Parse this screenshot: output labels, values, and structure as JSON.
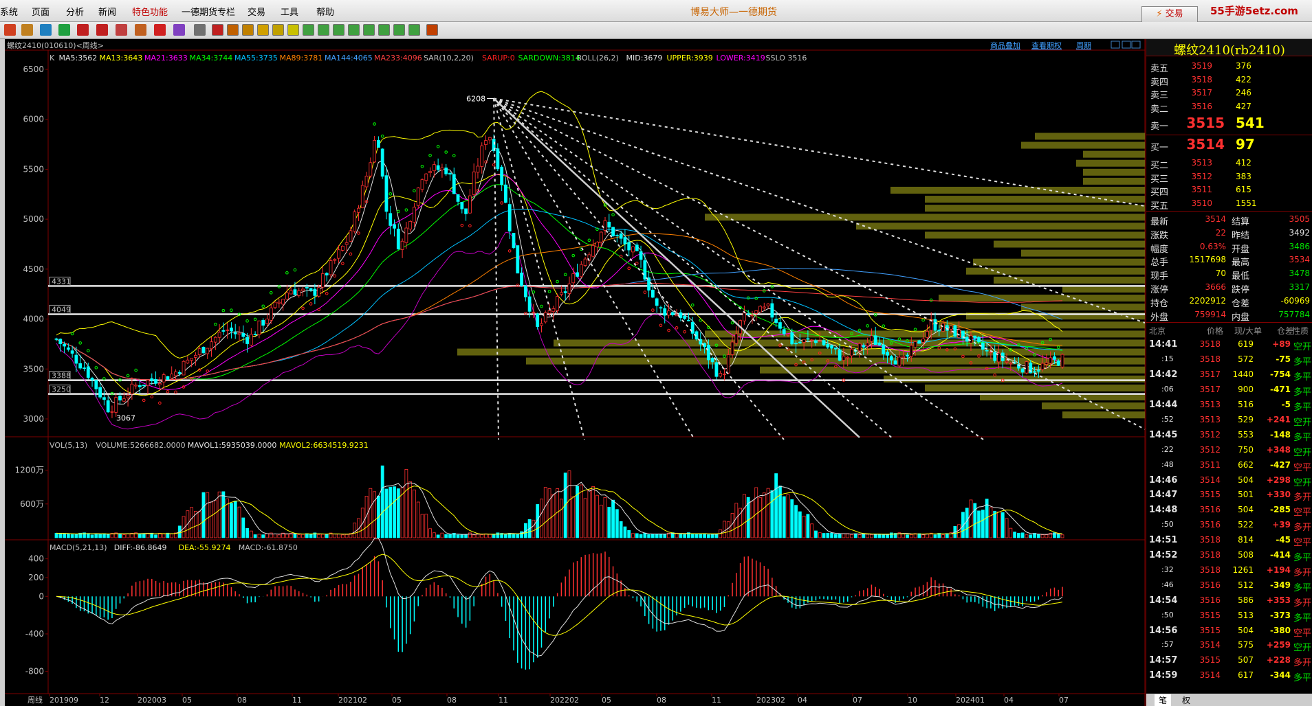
{
  "app": {
    "title": "博易大师—一德期货",
    "menus": [
      "系统",
      "页面",
      "分析",
      "新闻",
      "特色功能",
      "一德期货专栏",
      "交易",
      "工具",
      "帮助"
    ],
    "trade_button": "交易",
    "watermark": "55手游5etz.com"
  },
  "chart": {
    "title": "螺纹2410(010610)<周线>",
    "top_links": [
      "商品叠加",
      "查看期权",
      "周期"
    ],
    "indicator_line": [
      {
        "text": "K",
        "color": "#c0c0c0"
      },
      {
        "text": "MA5:3562",
        "color": "#e0e0e0"
      },
      {
        "text": "MA13:3643",
        "color": "#ffff00"
      },
      {
        "text": "MA21:3633",
        "color": "#ff00ff"
      },
      {
        "text": "MA34:3744",
        "color": "#00ff00"
      },
      {
        "text": "MA55:3735",
        "color": "#00c0ff"
      },
      {
        "text": "MA89:3781",
        "color": "#ff8000"
      },
      {
        "text": "MA144:4065",
        "color": "#40a0ff"
      },
      {
        "text": "MA233:4096",
        "color": "#ff4040"
      },
      {
        "text": "SAR(10,2,20)",
        "color": "#c0c0c0"
      },
      {
        "text": "SARUP:0",
        "color": "#ff2020"
      },
      {
        "text": "SARDOWN:3814",
        "color": "#00ff00"
      },
      {
        "text": "BOLL(26,2)",
        "color": "#c0c0c0"
      },
      {
        "text": "MID:3679",
        "color": "#e0e0e0"
      },
      {
        "text": "UPPER:3939",
        "color": "#ffff00"
      },
      {
        "text": "LOWER:3419",
        "color": "#ff00ff"
      },
      {
        "text": "SSLO 3516",
        "color": "#c0c0c0"
      }
    ],
    "price_axis": [
      "6500",
      "6000",
      "5500",
      "5000",
      "4500",
      "4000",
      "3500",
      "3000"
    ],
    "level_labels": [
      "4331",
      "4049",
      "3388",
      "3250"
    ],
    "peak_label": "6208",
    "low_label": "3067",
    "vol_line": [
      {
        "text": "VOL(5,13)",
        "color": "#c0c0c0"
      },
      {
        "text": "VOLUME:5266682.0000",
        "color": "#c0c0c0"
      },
      {
        "text": "MAVOL1:5935039.0000",
        "color": "#e0e0e0"
      },
      {
        "text": "MAVOL2:6634519.9231",
        "color": "#ffff00"
      }
    ],
    "vol_axis": [
      "1200万",
      "600万"
    ],
    "macd_line": [
      {
        "text": "MACD(5,21,13)",
        "color": "#c0c0c0"
      },
      {
        "text": "DIFF:-86.8649",
        "color": "#e0e0e0"
      },
      {
        "text": "DEA:-55.9274",
        "color": "#ffff00"
      },
      {
        "text": "MACD:-61.8750",
        "color": "#c0c0c0"
      }
    ],
    "macd_axis": [
      "400",
      "200",
      "0",
      "-400",
      "-800"
    ],
    "period_label": "周线",
    "time_axis": [
      "201909",
      "12",
      "202003",
      "05",
      "08",
      "11",
      "202102",
      "05",
      "08",
      "11",
      "202202",
      "05",
      "08",
      "11",
      "202302",
      "04",
      "07",
      "10",
      "202401",
      "04",
      "07"
    ]
  },
  "quote": {
    "title": "螺纹2410(rb2410)",
    "asks": [
      {
        "label": "卖五",
        "price": "3519",
        "vol": "376"
      },
      {
        "label": "卖四",
        "price": "3518",
        "vol": "422"
      },
      {
        "label": "卖三",
        "price": "3517",
        "vol": "246"
      },
      {
        "label": "卖二",
        "price": "3516",
        "vol": "427"
      }
    ],
    "ask1": {
      "label": "卖一",
      "price": "3515",
      "vol": "541"
    },
    "bid1": {
      "label": "买一",
      "price": "3514",
      "vol": "97"
    },
    "bids": [
      {
        "label": "买二",
        "price": "3513",
        "vol": "412"
      },
      {
        "label": "买三",
        "price": "3512",
        "vol": "383"
      },
      {
        "label": "买四",
        "price": "3511",
        "vol": "615"
      },
      {
        "label": "买五",
        "price": "3510",
        "vol": "1551"
      }
    ],
    "stats": [
      {
        "l1": "最新",
        "v1": "3514",
        "c1": "#ff3030",
        "l2": "结算",
        "v2": "3505",
        "c2": "#ff3030"
      },
      {
        "l1": "涨跌",
        "v1": "22",
        "c1": "#ff3030",
        "l2": "昨结",
        "v2": "3492",
        "c2": "#e0e0e0"
      },
      {
        "l1": "幅度",
        "v1": "0.63%",
        "c1": "#ff3030",
        "l2": "开盘",
        "v2": "3486",
        "c2": "#00e000"
      },
      {
        "l1": "总手",
        "v1": "1517698",
        "c1": "#ffff00",
        "l2": "最高",
        "v2": "3534",
        "c2": "#ff3030"
      },
      {
        "l1": "现手",
        "v1": "70",
        "c1": "#ffff00",
        "l2": "最低",
        "v2": "3478",
        "c2": "#00e000"
      },
      {
        "l1": "涨停",
        "v1": "3666",
        "c1": "#ff3030",
        "l2": "跌停",
        "v2": "3317",
        "c2": "#00e000"
      },
      {
        "l1": "持仓",
        "v1": "2202912",
        "c1": "#ffff00",
        "l2": "仓差",
        "v2": "-60969",
        "c2": "#ffff00"
      },
      {
        "l1": "外盘",
        "v1": "759914",
        "c1": "#ff3030",
        "l2": "内盘",
        "v2": "757784",
        "c2": "#00e000"
      }
    ],
    "tick_header": [
      "北京",
      "价格",
      "现/大单",
      "仓差",
      "性质"
    ],
    "ticks": [
      {
        "t": "14:41",
        "p": "3518",
        "v": "619",
        "d": "+89",
        "n": "空开",
        "tb": true
      },
      {
        "t": ":15",
        "p": "3518",
        "v": "572",
        "d": "-75",
        "n": "多平",
        "tb": false
      },
      {
        "t": "14:42",
        "p": "3517",
        "v": "1440",
        "d": "-754",
        "n": "多平",
        "tb": true
      },
      {
        "t": ":06",
        "p": "3517",
        "v": "900",
        "d": "-471",
        "n": "多平",
        "tb": false
      },
      {
        "t": "14:44",
        "p": "3513",
        "v": "516",
        "d": "-5",
        "n": "多平",
        "tb": true
      },
      {
        "t": ":52",
        "p": "3513",
        "v": "529",
        "d": "+241",
        "n": "空开",
        "tb": false
      },
      {
        "t": "14:45",
        "p": "3512",
        "v": "553",
        "d": "-148",
        "n": "多平",
        "tb": true
      },
      {
        "t": ":22",
        "p": "3512",
        "v": "750",
        "d": "+348",
        "n": "空开",
        "tb": false
      },
      {
        "t": ":48",
        "p": "3511",
        "v": "662",
        "d": "-427",
        "n": "空平",
        "tb": false
      },
      {
        "t": "14:46",
        "p": "3514",
        "v": "504",
        "d": "+298",
        "n": "空开",
        "tb": true
      },
      {
        "t": "14:47",
        "p": "3515",
        "v": "501",
        "d": "+330",
        "n": "多开",
        "tb": true
      },
      {
        "t": "14:48",
        "p": "3516",
        "v": "504",
        "d": "-285",
        "n": "空平",
        "tb": true
      },
      {
        "t": ":50",
        "p": "3516",
        "v": "522",
        "d": "+39",
        "n": "多开",
        "tb": false
      },
      {
        "t": "14:51",
        "p": "3518",
        "v": "814",
        "d": "-45",
        "n": "空平",
        "tb": true
      },
      {
        "t": "14:52",
        "p": "3518",
        "v": "508",
        "d": "-414",
        "n": "多平",
        "tb": true
      },
      {
        "t": ":32",
        "p": "3518",
        "v": "1261",
        "d": "+194",
        "n": "多开",
        "tb": false
      },
      {
        "t": ":46",
        "p": "3516",
        "v": "512",
        "d": "-349",
        "n": "多平",
        "tb": false
      },
      {
        "t": "14:54",
        "p": "3516",
        "v": "586",
        "d": "+353",
        "n": "多开",
        "tb": true
      },
      {
        "t": ":50",
        "p": "3515",
        "v": "513",
        "d": "-373",
        "n": "多平",
        "tb": false
      },
      {
        "t": "14:56",
        "p": "3515",
        "v": "504",
        "d": "-380",
        "n": "空平",
        "tb": true
      },
      {
        "t": ":57",
        "p": "3514",
        "v": "575",
        "d": "+259",
        "n": "空开",
        "tb": false
      },
      {
        "t": "14:57",
        "p": "3515",
        "v": "507",
        "d": "+228",
        "n": "多开",
        "tb": true
      },
      {
        "t": "14:59",
        "p": "3514",
        "v": "617",
        "d": "-344",
        "n": "多平",
        "tb": true
      }
    ],
    "bottom_tabs": [
      "笔",
      "权"
    ]
  }
}
